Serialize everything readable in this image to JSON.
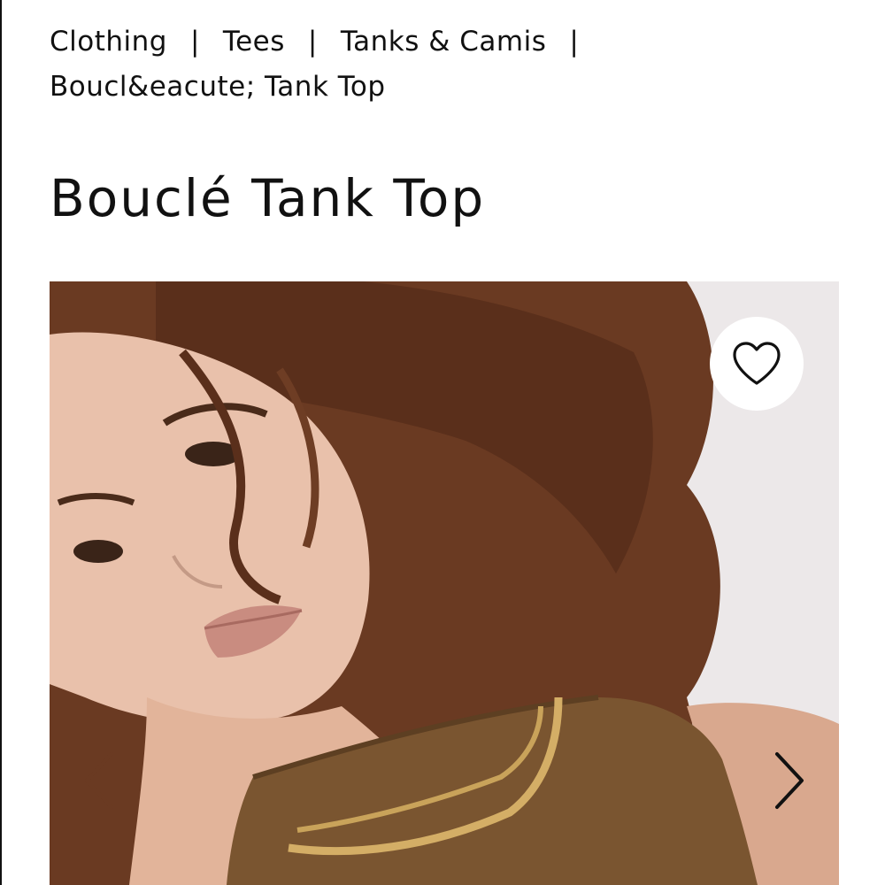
{
  "breadcrumb": {
    "items": [
      "Clothing",
      "Tees",
      "Tanks & Camis",
      "Boucl&eacute; Tank Top"
    ],
    "separator": "|"
  },
  "product": {
    "title": "Bouclé Tank Top"
  },
  "gallery": {
    "favorite_icon": "heart-outline-icon",
    "prev_icon": "chevron-left-icon",
    "next_icon": "chevron-right-icon",
    "background_color": "#ede9ea"
  }
}
